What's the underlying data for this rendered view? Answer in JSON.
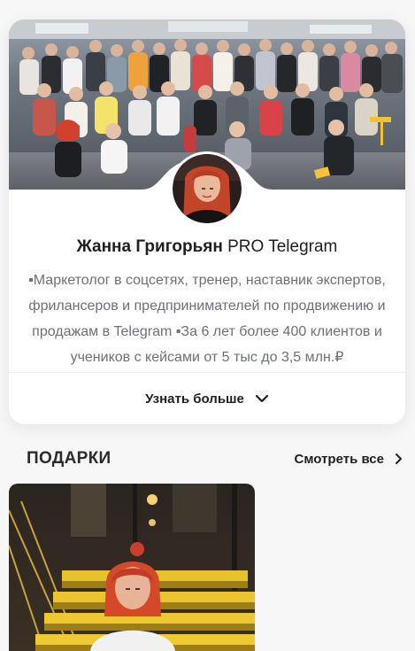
{
  "profile": {
    "cover_alt": "group-photo",
    "avatar_alt": "profile-photo",
    "name_bold": "Жанна Григорьян",
    "name_rest": " PRO Telegram",
    "bio": "▪Маркетолог в соцсетях, тренер, наставник экспертов, фрилансеров и предпринимателей по продвижению и продажам в Telegram ▪За 6 лет более 400 клиентов и учеников с кейсами от 5 тыс до 3,5 млн.₽",
    "more_label": "Узнать больше",
    "more_icon": "chevron-down-icon"
  },
  "gifts": {
    "title": "ПОДАРКИ",
    "see_all_label": "Смотреть все",
    "see_all_icon": "chevron-right-icon",
    "items": [
      {
        "image": "gift-photo-woman-on-stairs"
      }
    ]
  },
  "colors": {
    "card_bg": "#ffffff",
    "page_bg": "#f7f7f8",
    "text_primary": "#1d1f22",
    "text_secondary": "#6b7079",
    "stairs_yellow": "#e8c22c"
  }
}
